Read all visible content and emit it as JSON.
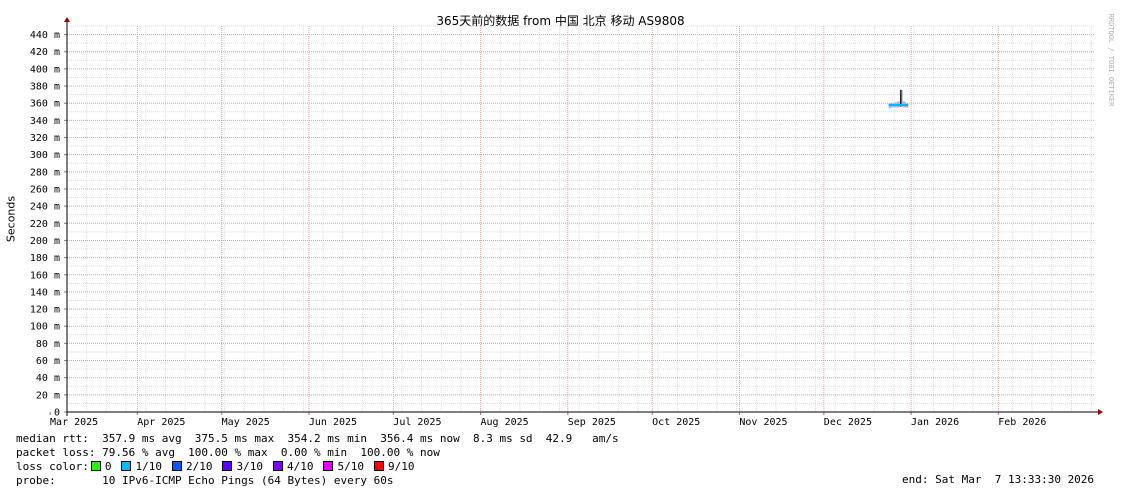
{
  "chart_data": {
    "type": "area",
    "title": "365天前的数据 from  中国 北京 移动 AS9808",
    "ylabel": "Seconds",
    "ylim": [
      0,
      450
    ],
    "yticks": [
      0,
      20,
      40,
      60,
      80,
      100,
      120,
      140,
      160,
      180,
      200,
      220,
      240,
      260,
      280,
      300,
      320,
      340,
      360,
      380,
      400,
      420,
      440
    ],
    "ytick_labels": [
      "0",
      "20 m",
      "40 m",
      "60 m",
      "80 m",
      "100 m",
      "120 m",
      "140 m",
      "160 m",
      "180 m",
      "200 m",
      "220 m",
      "240 m",
      "260 m",
      "280 m",
      "300 m",
      "320 m",
      "340 m",
      "360 m",
      "380 m",
      "400 m",
      "420 m",
      "440 m"
    ],
    "x_range": [
      "2025-03-07",
      "2026-03-07"
    ],
    "x_labels": [
      {
        "label": "Mar 2025",
        "date": "2025-03-01"
      },
      {
        "label": "Apr 2025",
        "date": "2025-04-01"
      },
      {
        "label": "May 2025",
        "date": "2025-05-01"
      },
      {
        "label": "Jun 2025",
        "date": "2025-06-01"
      },
      {
        "label": "Jul 2025",
        "date": "2025-07-01"
      },
      {
        "label": "Aug 2025",
        "date": "2025-08-01"
      },
      {
        "label": "Sep 2025",
        "date": "2025-09-01"
      },
      {
        "label": "Oct 2025",
        "date": "2025-10-01"
      },
      {
        "label": "Nov 2025",
        "date": "2025-11-01"
      },
      {
        "label": "Dec 2025",
        "date": "2025-12-01"
      },
      {
        "label": "Jan 2026",
        "date": "2026-01-01"
      },
      {
        "label": "Feb 2026",
        "date": "2026-02-01"
      }
    ],
    "grid": true,
    "series": [
      {
        "points": [
          {
            "x": "2025-12-24",
            "y_min_ms": 354,
            "y_max_ms": 360
          },
          {
            "x": "2025-12-25",
            "y_min_ms": 355,
            "y_max_ms": 360
          },
          {
            "x": "2025-12-26",
            "y_min_ms": 355,
            "y_max_ms": 361
          },
          {
            "x": "2025-12-27",
            "y_min_ms": 355,
            "y_max_ms": 362
          },
          {
            "x": "2025-12-28",
            "y_min_ms": 356,
            "y_max_ms": 375.5
          },
          {
            "x": "2025-12-29",
            "y_min_ms": 355,
            "y_max_ms": 362
          },
          {
            "x": "2025-12-30",
            "y_min_ms": 355,
            "y_max_ms": 360
          }
        ],
        "median_ms": 357.9,
        "color": "#00b8ff"
      }
    ],
    "loss_colors": [
      {
        "label": "0",
        "color": "#26ff00"
      },
      {
        "label": "1/10",
        "color": "#00b8ff"
      },
      {
        "label": "2/10",
        "color": "#0059ff"
      },
      {
        "label": "3/10",
        "color": "#5e00ff"
      },
      {
        "label": "4/10",
        "color": "#7e00ff"
      },
      {
        "label": "5/10",
        "color": "#dd00ff"
      },
      {
        "label": "9/10",
        "color": "#ff0000"
      }
    ]
  },
  "legend": {
    "median_rtt": "median rtt:  357.9 ms avg  375.5 ms max  354.2 ms min  356.4 ms now  8.3 ms sd  42.9   am/s",
    "packet_loss": "packet loss: 79.56 % avg  100.00 % max  0.00 % min  100.00 % now",
    "loss_color_label": "loss color:",
    "probe": "probe:       10 IPv6-ICMP Echo Pings (64 Bytes) every 60s",
    "end": "end: Sat Mar  7 13:33:30 2026"
  },
  "watermark": "RRDTOOL / TOBI OETIKER"
}
